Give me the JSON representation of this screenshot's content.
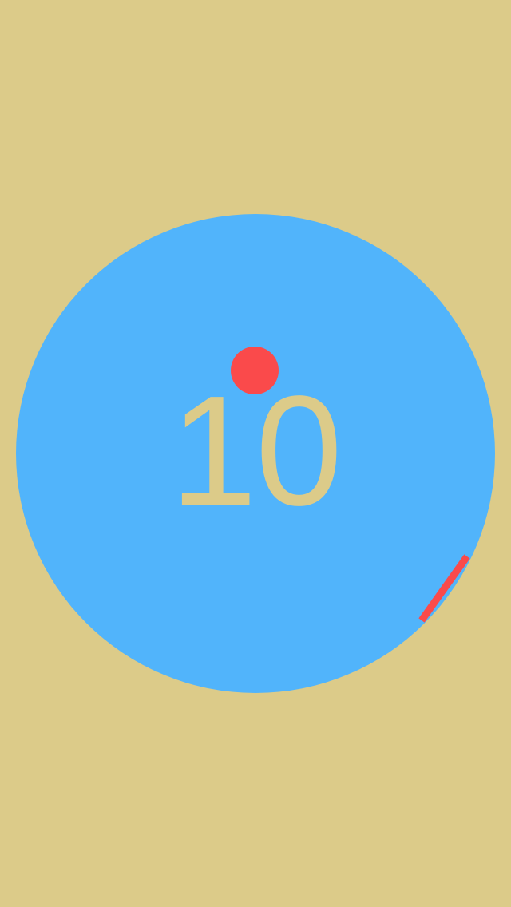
{
  "game": {
    "score": "10",
    "colors": {
      "background": "#dccb89",
      "arena": "#51b4fb",
      "ball": "#fa4a4b",
      "paddle": "#fa4a4b",
      "score_text": "#dccb89"
    }
  }
}
